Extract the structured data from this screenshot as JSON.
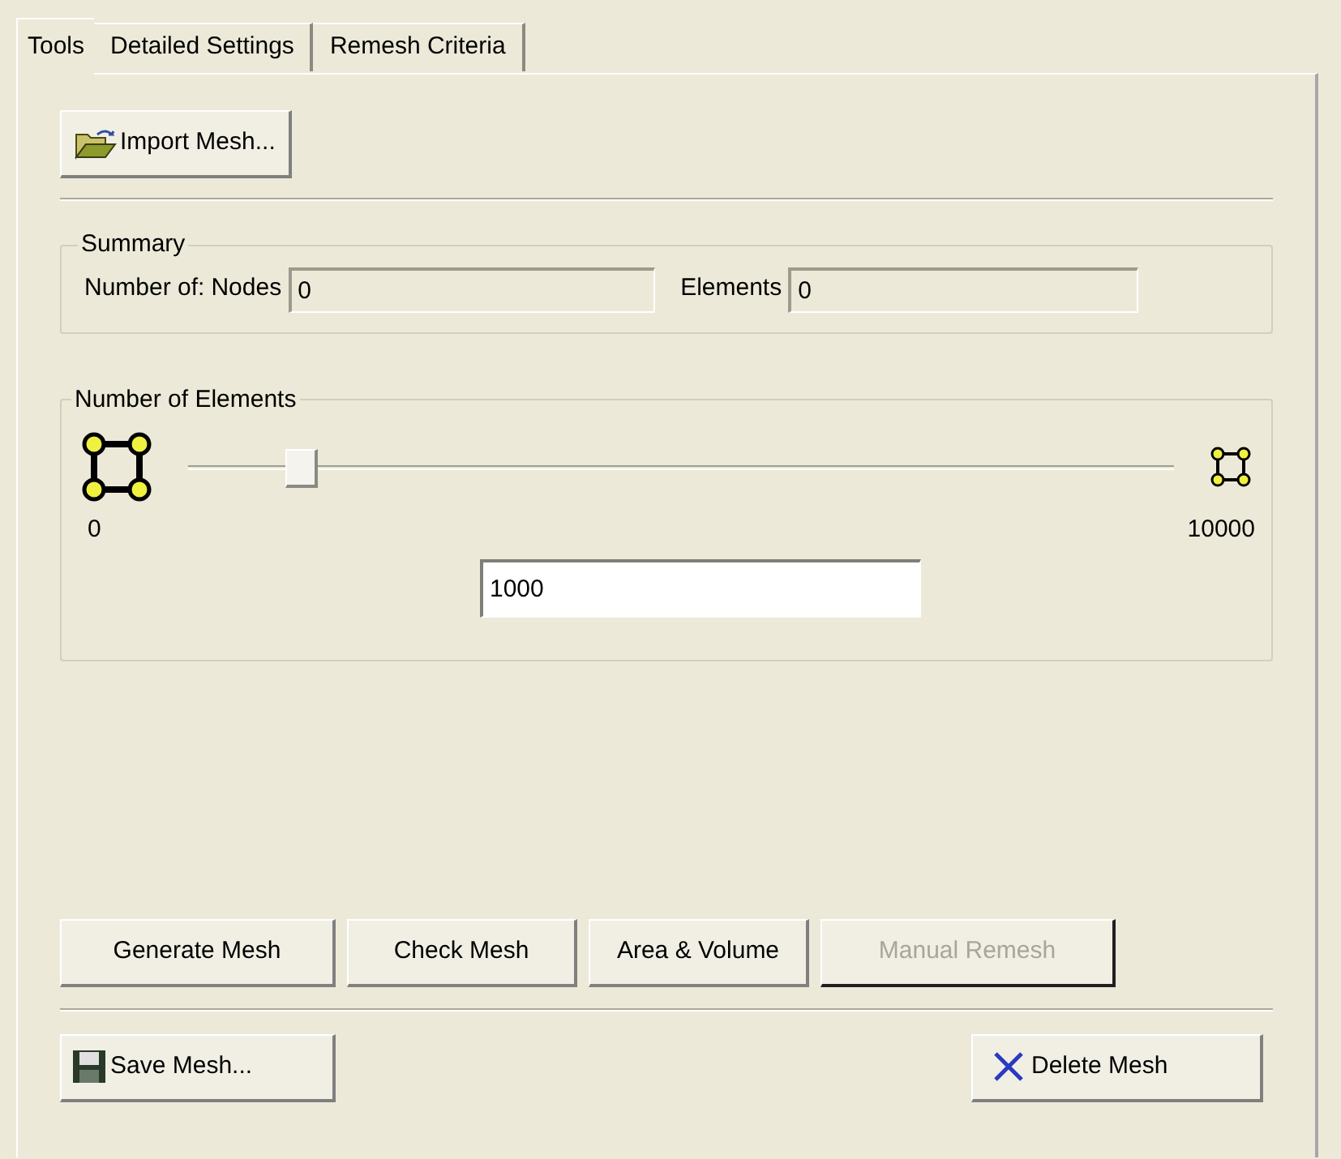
{
  "tabs": [
    {
      "label": "Tools",
      "selected": true
    },
    {
      "label": "Detailed Settings",
      "selected": false
    },
    {
      "label": "Remesh Criteria",
      "selected": false
    }
  ],
  "import_button": {
    "label": "Import Mesh..."
  },
  "summary": {
    "title": "Summary",
    "prefix": "Number of:",
    "fields": [
      {
        "label": "Nodes",
        "value": "0"
      },
      {
        "label": "Elements",
        "value": "0"
      }
    ]
  },
  "number_of_elements": {
    "title": "Number of Elements",
    "slider": {
      "level": 0.1,
      "min_label": "0",
      "max_label": "10000"
    },
    "value": "1000"
  },
  "actions": [
    {
      "label": "Generate Mesh",
      "disabled": false
    },
    {
      "label": "Check Mesh",
      "disabled": false
    },
    {
      "label": "Area & Volume",
      "disabled": false
    },
    {
      "label": "Manual Remesh",
      "disabled": true
    }
  ],
  "save_button": {
    "label": "Save Mesh..."
  },
  "delete_button": {
    "label": "Delete Mesh"
  }
}
